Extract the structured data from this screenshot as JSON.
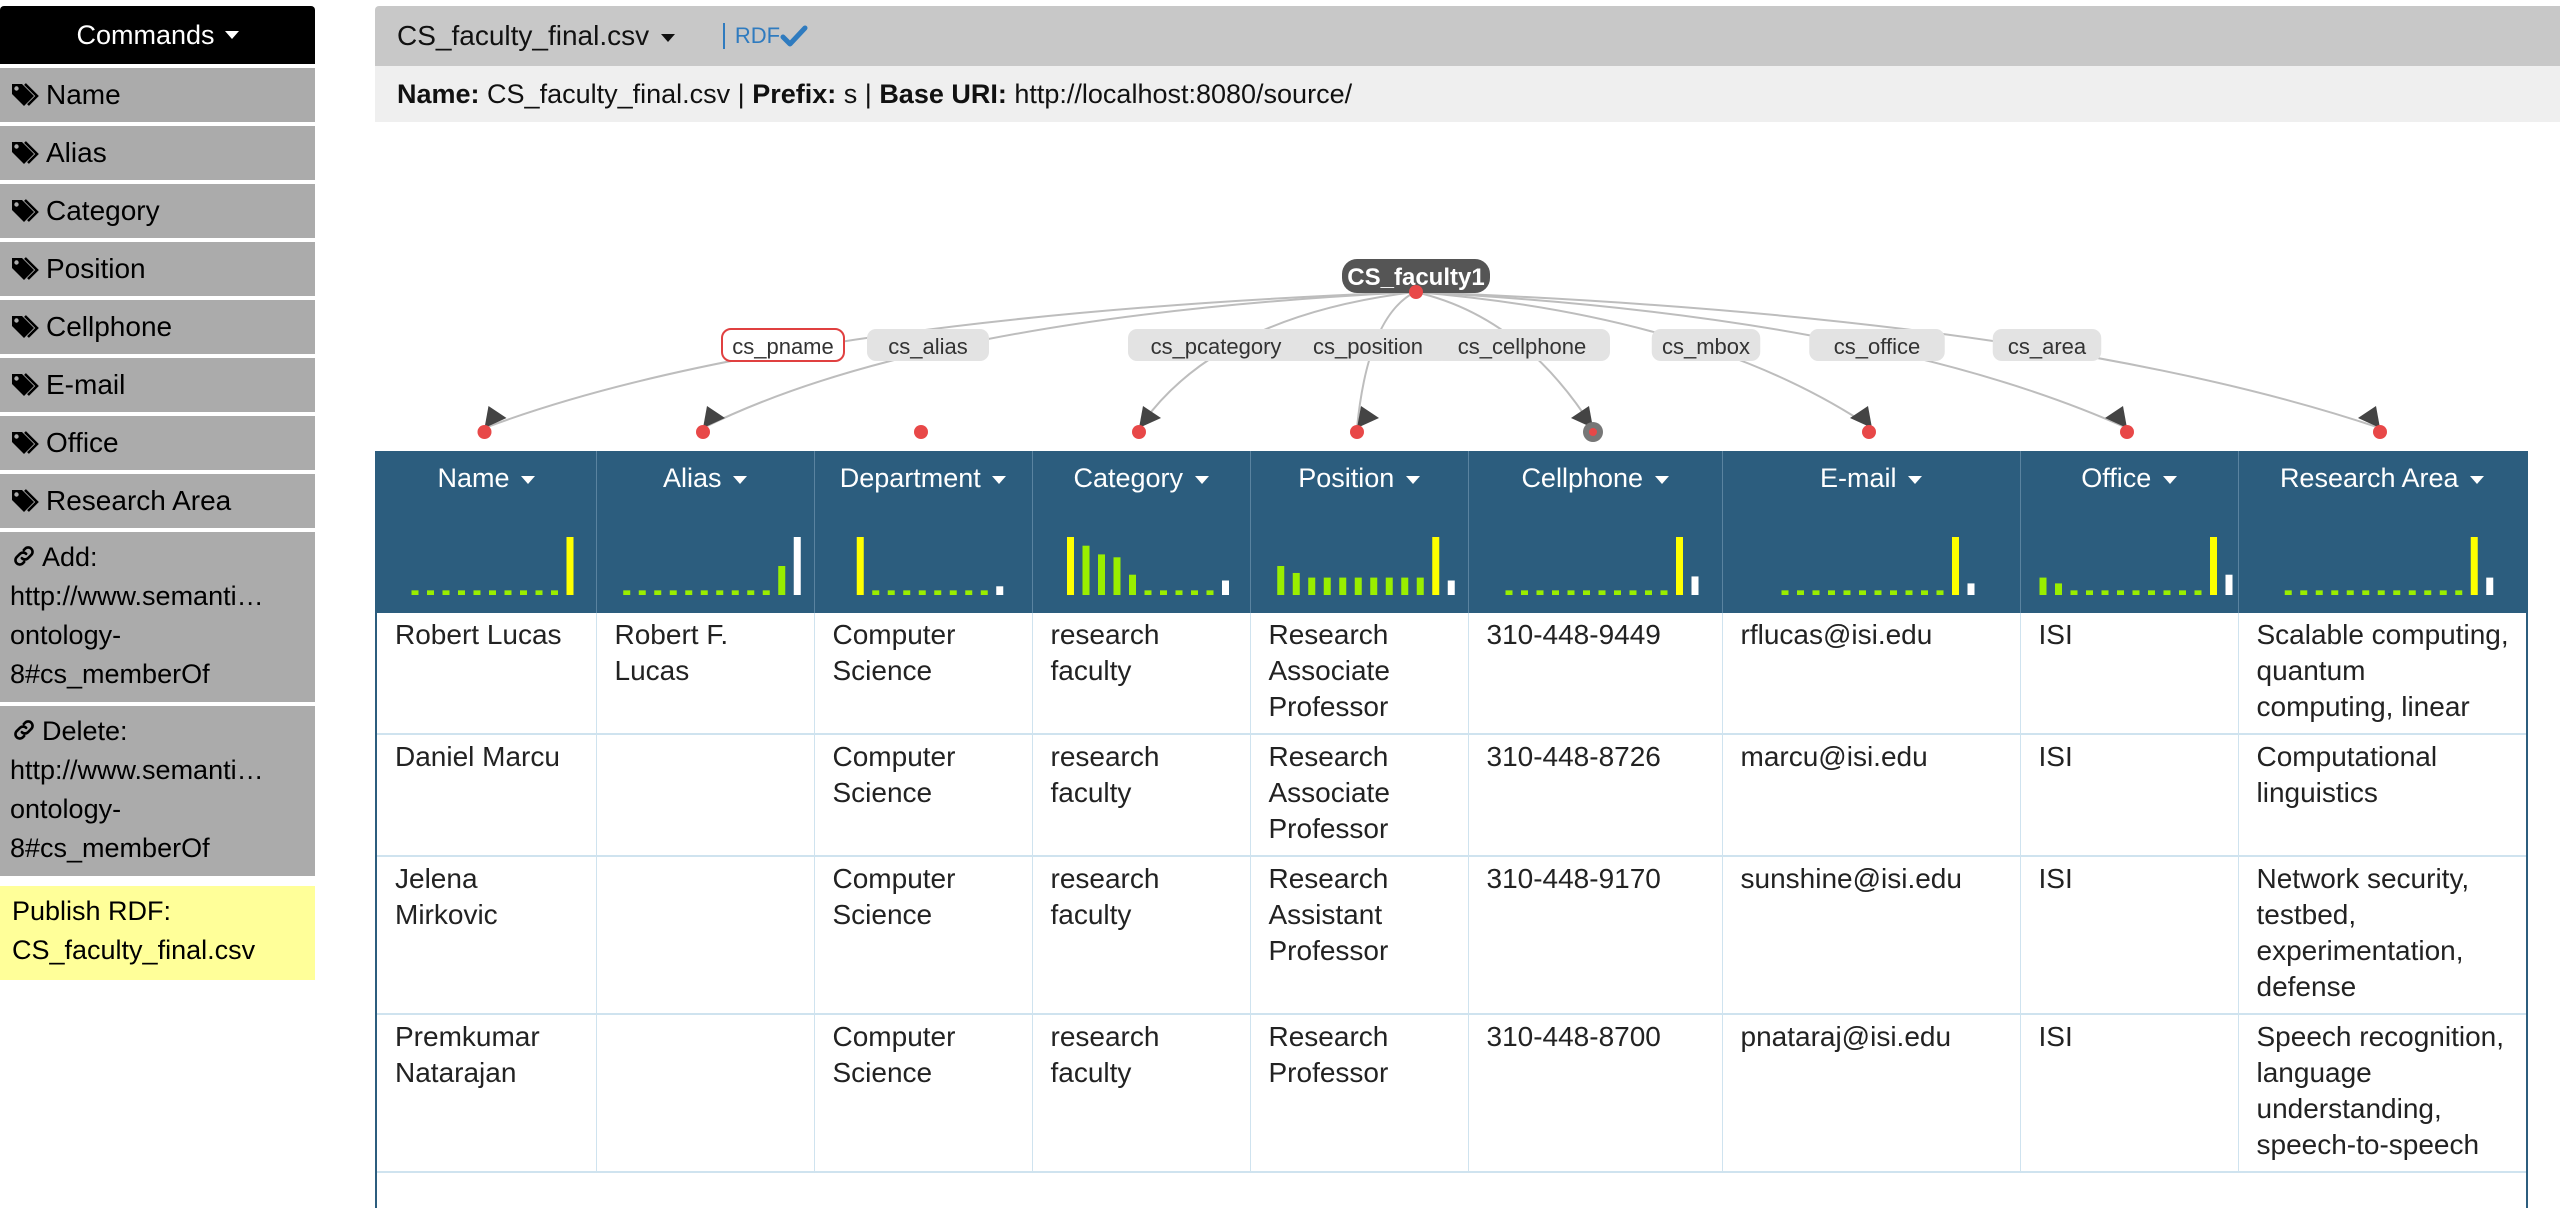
{
  "sidebar": {
    "header": "Commands",
    "items": [
      {
        "label": "Name",
        "icon": "tags-icon"
      },
      {
        "label": "Alias",
        "icon": "tags-icon"
      },
      {
        "label": "Category",
        "icon": "tags-icon"
      },
      {
        "label": "Position",
        "icon": "tags-icon"
      },
      {
        "label": "Cellphone",
        "icon": "tags-icon"
      },
      {
        "label": "E-mail",
        "icon": "tags-icon"
      },
      {
        "label": "Office",
        "icon": "tags-icon"
      },
      {
        "label": "Research Area",
        "icon": "tags-icon"
      }
    ],
    "add": {
      "line1": "Add:",
      "line2": "http://www.semanti…",
      "line3": "ontology-",
      "line4": "8#cs_memberOf",
      "icon": "link-icon"
    },
    "delete": {
      "line1": "Delete:",
      "line2": "http://www.semanti…",
      "line3": "ontology-",
      "line4": "8#cs_memberOf",
      "icon": "link-icon"
    },
    "publish": {
      "line1": "Publish RDF:",
      "line2": "CS_faculty_final.csv"
    }
  },
  "worksheet": {
    "title": "CS_faculty_final.csv",
    "rdf_label": "RDF",
    "info": {
      "name_label": "Name:",
      "name_value": "CS_faculty_final.csv",
      "prefix_label": "Prefix:",
      "prefix_value": "s",
      "base_label": "Base URI:",
      "base_value": "http://localhost:8080/source/",
      "sep": "|"
    }
  },
  "graph": {
    "root": "CS_faculty1",
    "properties": [
      "cs_pname",
      "cs_alias",
      "cs_pcategory",
      "cs_position",
      "cs_cellphone",
      "cs_mbox",
      "cs_office",
      "cs_area"
    ],
    "selected_property": "cs_pname"
  },
  "table": {
    "columns": [
      "Name",
      "Alias",
      "Department",
      "Category",
      "Position",
      "Cellphone",
      "E-mail",
      "Office",
      "Research Area"
    ],
    "rows": [
      [
        "Robert Lucas",
        "Robert F. Lucas",
        "Computer Science",
        "research faculty",
        "Research Associate Professor",
        "310-448-9449",
        "rflucas@isi.edu",
        "ISI",
        "Scalable computing, quantum computing, linear"
      ],
      [
        "Daniel Marcu",
        "",
        "Computer Science",
        "research faculty",
        "Research Associate Professor",
        "310-448-8726",
        "marcu@isi.edu",
        "ISI",
        "Computational linguistics"
      ],
      [
        "Jelena Mirkovic",
        "",
        "Computer Science",
        "research faculty",
        "Research Assistant Professor",
        "310-448-9170",
        "sunshine@isi.edu",
        "ISI",
        "Network security, testbed, experimentation, defense"
      ],
      [
        "Premkumar Natarajan",
        "",
        "Computer Science",
        "research faculty",
        "Research Professor",
        "310-448-8700",
        "pnataraj@isi.edu",
        "ISI",
        "Speech recognition, language understanding, speech-to-speech"
      ]
    ],
    "histograms": [
      {
        "bars": [
          0.08,
          0.08,
          0.08,
          0.08,
          0.08,
          0.08,
          0.08,
          0.08,
          0.08,
          0.08,
          1.0
        ],
        "last_white": false
      },
      {
        "bars": [
          0.08,
          0.08,
          0.08,
          0.08,
          0.08,
          0.08,
          0.08,
          0.08,
          0.08,
          0.08,
          0.5,
          1.0
        ],
        "last_white": true
      },
      {
        "bars": [
          1.0,
          0.08,
          0.08,
          0.08,
          0.08,
          0.08,
          0.08,
          0.08,
          0.08,
          0.15
        ],
        "last_white": true
      },
      {
        "bars": [
          1.0,
          0.85,
          0.7,
          0.65,
          0.35,
          0.08,
          0.08,
          0.08,
          0.08,
          0.08,
          0.25
        ],
        "last_white": true
      },
      {
        "bars": [
          0.5,
          0.38,
          0.3,
          0.3,
          0.3,
          0.3,
          0.3,
          0.3,
          0.3,
          0.3,
          1.0,
          0.25
        ],
        "last_white": true
      },
      {
        "bars": [
          0.08,
          0.08,
          0.08,
          0.08,
          0.08,
          0.08,
          0.08,
          0.08,
          0.08,
          0.08,
          0.08,
          1.0,
          0.32
        ],
        "last_white": true
      },
      {
        "bars": [
          0.08,
          0.08,
          0.08,
          0.08,
          0.08,
          0.08,
          0.08,
          0.08,
          0.08,
          0.08,
          0.08,
          1.0,
          0.2
        ],
        "last_white": true
      },
      {
        "bars": [
          0.3,
          0.2,
          0.08,
          0.08,
          0.08,
          0.08,
          0.08,
          0.08,
          0.08,
          0.08,
          0.08,
          1.0,
          0.35
        ],
        "last_white": true
      },
      {
        "bars": [
          0.08,
          0.08,
          0.08,
          0.08,
          0.08,
          0.08,
          0.08,
          0.08,
          0.08,
          0.08,
          0.08,
          0.08,
          1.0,
          0.3
        ],
        "last_white": true
      }
    ]
  },
  "colors": {
    "header_bg": "#2c5d7e",
    "bar_yellow": "#ffff00",
    "bar_green": "#99ee00",
    "node_red": "#e84848",
    "publish_bg": "#ffff99"
  }
}
